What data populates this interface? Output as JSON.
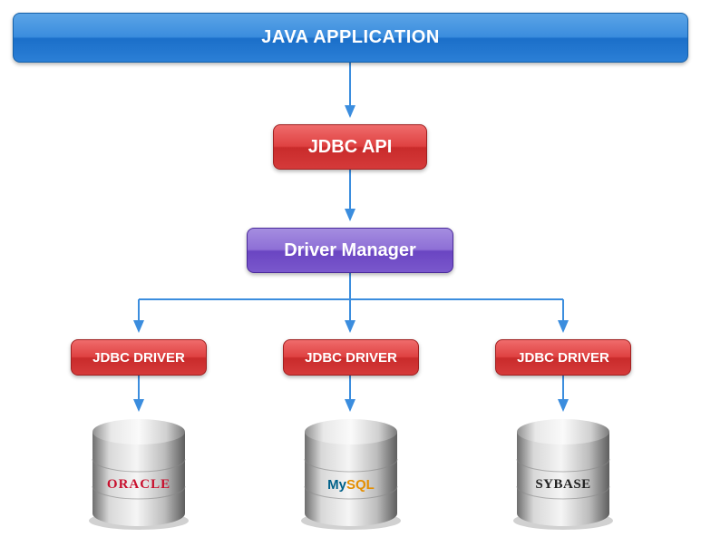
{
  "nodes": {
    "app": "JAVA APPLICATION",
    "api": "JDBC API",
    "manager": "Driver Manager",
    "driver": "JDBC DRIVER"
  },
  "databases": {
    "oracle": "ORACLE",
    "mysql_a": "My",
    "mysql_b": "SQL",
    "sybase": "SYBASE"
  },
  "colors": {
    "arrow": "#3b8dde",
    "blue_box": "#2b7fd6",
    "red_box": "#d53a3a",
    "purple_box": "#7a58cc"
  }
}
